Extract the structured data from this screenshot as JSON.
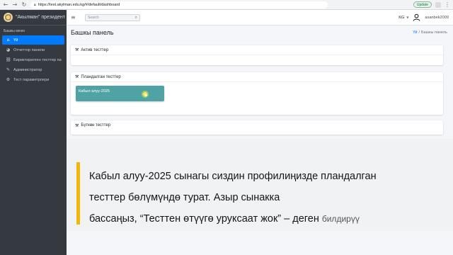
{
  "browser": {
    "url": "https://test.akylman.edu.kg/#/default/dashboard",
    "update_label": "Update"
  },
  "sidebar": {
    "brand": "\"Акылман\" президент",
    "menu_header": "Башкы меню",
    "items": [
      {
        "label": "Үй",
        "icon": "home-icon",
        "active": true
      },
      {
        "label": "Отчеттор панели",
        "icon": "dashboard-icon"
      },
      {
        "label": "Бириктирилген тесттер па",
        "icon": "link-icon"
      },
      {
        "label": "Администратор",
        "icon": "wrench-icon"
      },
      {
        "label": "Тест параметрлери",
        "icon": "sliders-icon"
      }
    ]
  },
  "navbar": {
    "search_placeholder": "Search",
    "language": "KG",
    "username": "asanbek2009"
  },
  "page": {
    "title": "Башкы панель",
    "breadcrumb_home": "Үй",
    "breadcrumb_sep": "/",
    "breadcrumb_current": "Башкы панель"
  },
  "cards": {
    "active": {
      "title": "Актив тесттер"
    },
    "planned": {
      "title": "Пландалган тесттер",
      "tile": "Кабыл алуу-2025"
    },
    "finished": {
      "title": "Бүткөн тесттер"
    }
  },
  "caption": {
    "line1": "Кабыл алуу-2025 сынагы сиздин профилиңизде пландалган",
    "line2": "тесттер бөлүмүндө турат. Азыр сынакка",
    "line3": "бассаңыз, “Тесттен өтүүгө уруксаат жок” – деген",
    "tail": "билдирүү"
  },
  "colors": {
    "sidebar_bg": "#343a40",
    "active_item": "#007bff",
    "tile": "#4fa3a5",
    "caption_accent": "#f2b705"
  }
}
